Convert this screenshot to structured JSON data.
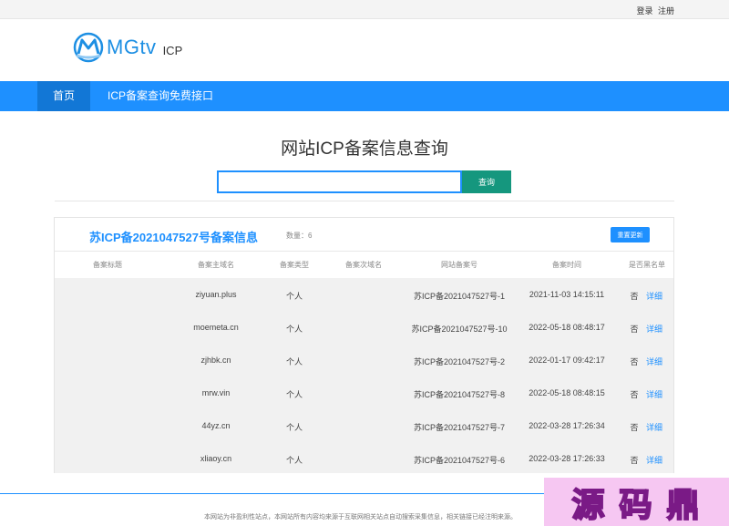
{
  "topbar": {
    "login": "登录",
    "register": "注册"
  },
  "logo": {
    "brand": "MGtv",
    "suffix": "ICP"
  },
  "nav": {
    "home": "首页",
    "api": "ICP备案查询免费接口"
  },
  "page_title": "网站ICP备案信息查询",
  "search": {
    "value": "",
    "placeholder": "",
    "button": "查询"
  },
  "panel": {
    "title": "苏ICP备2021047527号备案信息",
    "count_label": "数量：6",
    "refresh_button": "重置更新",
    "columns": [
      "备案标题",
      "备案主域名",
      "备案类型",
      "备案次域名",
      "网站备案号",
      "备案时间",
      "是否黑名单"
    ],
    "rows": [
      {
        "title": "",
        "domain": "ziyuan.plus",
        "type": "个人",
        "sub": "",
        "icp": "苏ICP备2021047527号-1",
        "time": "2021-11-03 14:15:11",
        "blacklist": "否",
        "detail": "详细"
      },
      {
        "title": "",
        "domain": "moemeta.cn",
        "type": "个人",
        "sub": "",
        "icp": "苏ICP备2021047527号-10",
        "time": "2022-05-18 08:48:17",
        "blacklist": "否",
        "detail": "详细"
      },
      {
        "title": "",
        "domain": "zjhbk.cn",
        "type": "个人",
        "sub": "",
        "icp": "苏ICP备2021047527号-2",
        "time": "2022-01-17 09:42:17",
        "blacklist": "否",
        "detail": "详细"
      },
      {
        "title": "",
        "domain": "mrw.vin",
        "type": "个人",
        "sub": "",
        "icp": "苏ICP备2021047527号-8",
        "time": "2022-05-18 08:48:15",
        "blacklist": "否",
        "detail": "详细"
      },
      {
        "title": "",
        "domain": "44yz.cn",
        "type": "个人",
        "sub": "",
        "icp": "苏ICP备2021047527号-7",
        "time": "2022-03-28 17:26:34",
        "blacklist": "否",
        "detail": "详细"
      },
      {
        "title": "",
        "domain": "xliaoy.cn",
        "type": "个人",
        "sub": "",
        "icp": "苏ICP备2021047527号-6",
        "time": "2022-03-28 17:26:33",
        "blacklist": "否",
        "detail": "详细"
      }
    ]
  },
  "footer": {
    "text": "本网站为非盈利性站点，本网站所有内容均来源于互联网相关站点自动搜索采集信息，相关链接已经注明来源。"
  },
  "watermark": {
    "chars": [
      "源",
      "码",
      "鼎"
    ]
  },
  "colors": {
    "accent": "#1e90ff",
    "search_button": "#15977e",
    "row_bg": "#f1f1f1",
    "watermark_bg": "#f6c7f2",
    "watermark_stroke": "#7a1a86"
  }
}
